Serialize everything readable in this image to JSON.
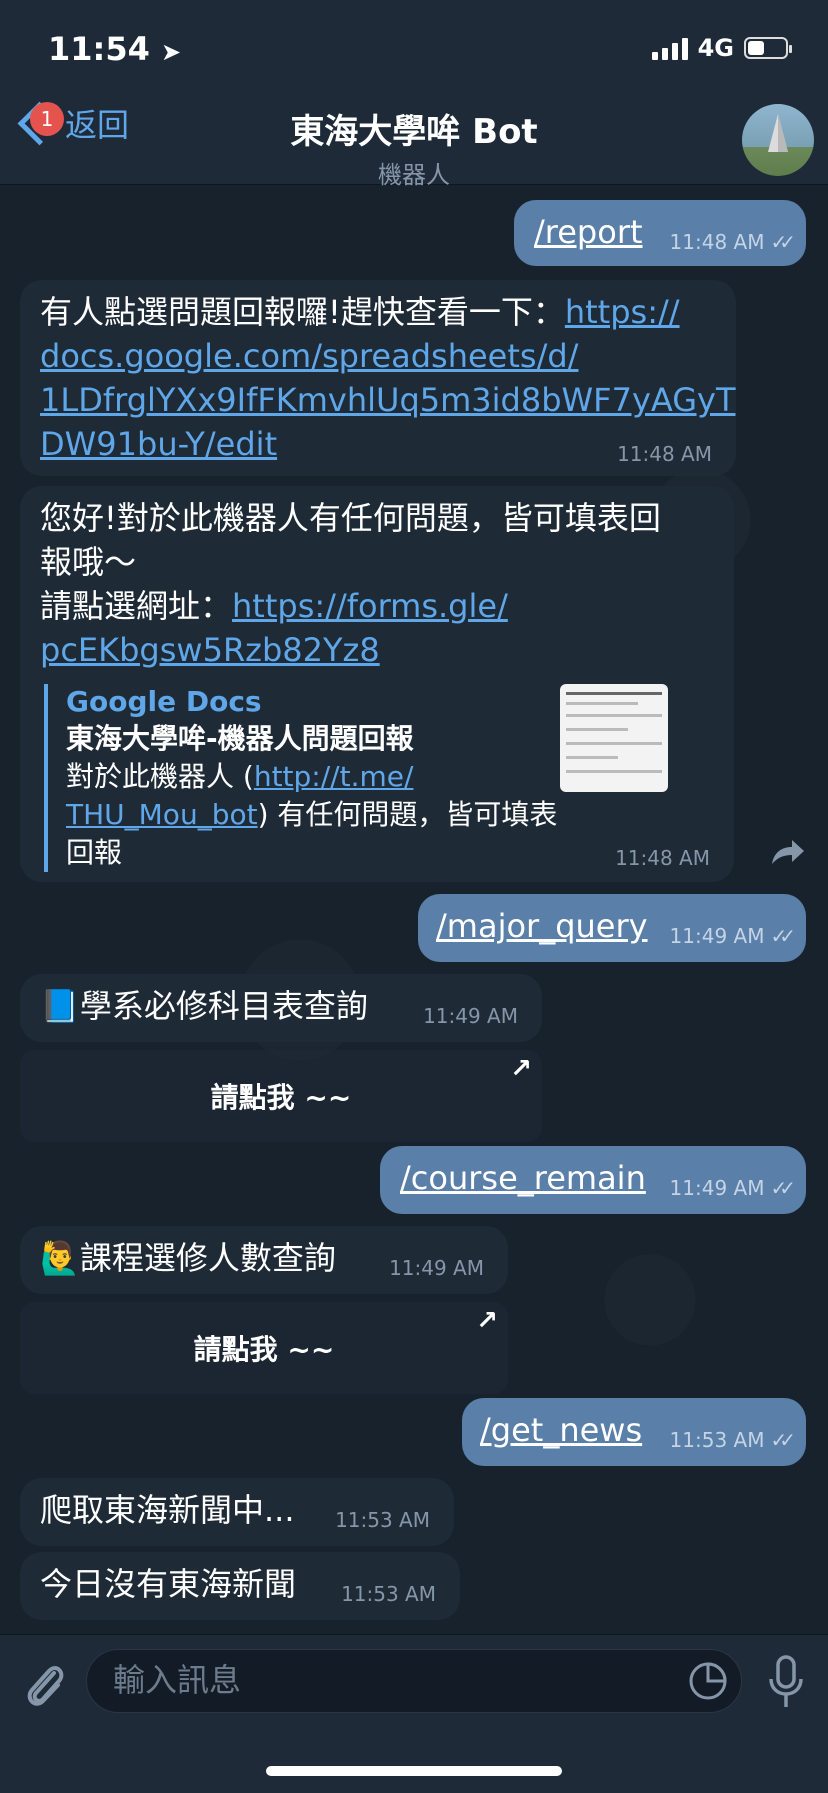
{
  "status": {
    "time": "11:54",
    "network": "4G",
    "battery_level": 0.45
  },
  "header": {
    "back_label": "返回",
    "back_badge": "1",
    "title": "東海大學哞 Bot",
    "subtitle": "機器人"
  },
  "messages": [
    {
      "type": "out",
      "text": "/report",
      "time": "11:48 AM"
    },
    {
      "type": "in",
      "text_prefix": "有人點選問題回報囉!趕快查看一下：",
      "link_lines": [
        "https://",
        "docs.google.com/spreadsheets/d/",
        "1LDfrglYXx9IfFKmvhlUq5m3id8bWF7yAGyT",
        "DW91bu-Y/edit"
      ],
      "text_line1": "有人點選問題回報囉!趕快查看一下：",
      "time": "11:48 AM"
    },
    {
      "type": "in",
      "line1": "您好!對於此機器人有任何問題，皆可填表回",
      "line2": "報哦～",
      "line3_prefix": "請點選網址：",
      "link1": "https://forms.gle/",
      "link2": "pcEKbgsw5Rzb82Yz8",
      "preview": {
        "site": "Google Docs",
        "title": "東海大學哞-機器人問題回報",
        "desc_prefix": "對於此機器人 (",
        "desc_link1": "http://t.me/",
        "desc_link2": "THU_Mou_bot",
        "desc_suffix": ") 有任何問題，皆可填表",
        "desc_line3": "回報"
      },
      "time": "11:48 AM"
    },
    {
      "type": "out",
      "text": "/major_query",
      "time": "11:49 AM"
    },
    {
      "type": "in",
      "emoji": "📘",
      "text": "學系必修科目表查詢",
      "time": "11:49 AM",
      "button": "請點我 ~~"
    },
    {
      "type": "out",
      "text": "/course_remain",
      "time": "11:49 AM"
    },
    {
      "type": "in",
      "emoji": "🙋‍♂️",
      "text": "課程選修人數查詢",
      "time": "11:49 AM",
      "button": "請點我 ~~"
    },
    {
      "type": "out",
      "text": "/get_news",
      "time": "11:53 AM"
    },
    {
      "type": "in",
      "text": "爬取東海新聞中...",
      "time": "11:53 AM"
    },
    {
      "type": "in",
      "text": "今日沒有東海新聞",
      "time": "11:53 AM"
    }
  ],
  "composer": {
    "placeholder": "輸入訊息"
  }
}
